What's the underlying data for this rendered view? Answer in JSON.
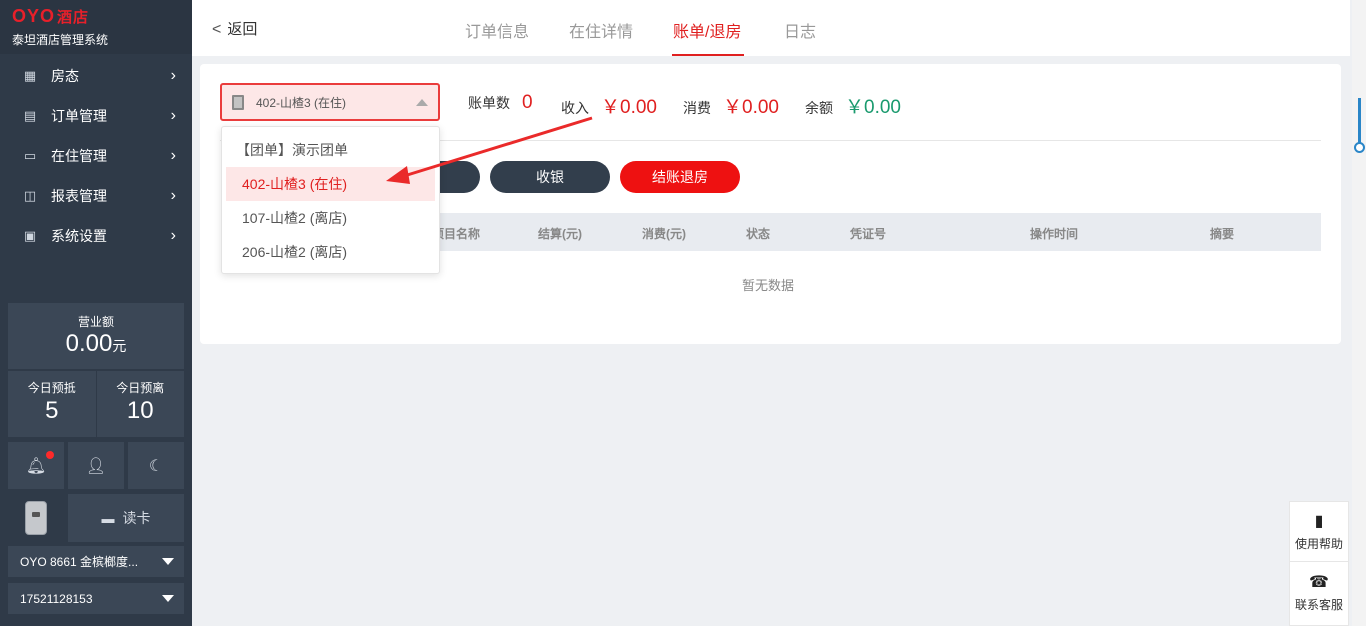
{
  "brand": {
    "logo": "OYO",
    "logo_cn": "酒店",
    "subtitle": "泰坦酒店管理系统"
  },
  "sidebar": {
    "menu": [
      {
        "label": "房态",
        "icon": "grid-icon"
      },
      {
        "label": "订单管理",
        "icon": "document-icon"
      },
      {
        "label": "在住管理",
        "icon": "bed-icon"
      },
      {
        "label": "报表管理",
        "icon": "chart-icon"
      },
      {
        "label": "系统设置",
        "icon": "monitor-icon"
      }
    ],
    "revenue": {
      "label": "营业额",
      "value": "0.00",
      "unit": "元"
    },
    "today_arrival": {
      "label": "今日预抵",
      "value": "5"
    },
    "today_departure": {
      "label": "今日预离",
      "value": "10"
    },
    "read_card": "读卡",
    "hotel_select": "OYO 8661 金槟榔度...",
    "phone_select": "17521128153"
  },
  "topbar": {
    "back": "返回",
    "tabs": [
      "订单信息",
      "在住详情",
      "账单/退房",
      "日志"
    ],
    "active_tab": "账单/退房"
  },
  "summary": {
    "room_selected": "402-山楂3 (在住)",
    "bill_count_label": "账单数",
    "bill_count": "0",
    "income_label": "收入",
    "income": "￥0.00",
    "consume_label": "消费",
    "consume": "￥0.00",
    "balance_label": "余额",
    "balance": "￥0.00"
  },
  "actions": {
    "cashier": "收银",
    "checkout": "结账退房"
  },
  "table": {
    "columns": [
      "项目名称",
      "结算(元)",
      "消费(元)",
      "状态",
      "凭证号",
      "操作时间",
      "摘要"
    ],
    "empty": "暂无数据"
  },
  "dropdown": {
    "items": [
      {
        "label": "【团单】演示团单"
      },
      {
        "label": "402-山楂3 (在住)"
      },
      {
        "label": "107-山楂2 (离店)"
      },
      {
        "label": "206-山楂2 (离店)"
      }
    ]
  },
  "help": {
    "usage": "使用帮助",
    "contact": "联系客服"
  },
  "colors": {
    "accent": "#e02020",
    "sidebar": "#2f3a48",
    "balance": "#1a9a6e"
  }
}
